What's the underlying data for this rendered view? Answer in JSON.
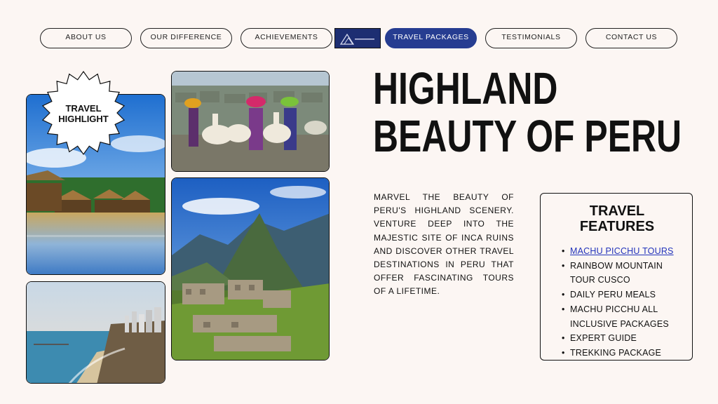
{
  "nav": {
    "items": [
      {
        "label": "ABOUT US"
      },
      {
        "label": "OUR DIFFERENCE"
      },
      {
        "label": "ACHIEVEMENTS"
      },
      {
        "label": "TRAVEL PACKAGES",
        "active": true
      },
      {
        "label": "TESTIMONIALS"
      },
      {
        "label": "CONTACT US"
      }
    ]
  },
  "badge": {
    "line1": "TRAVEL",
    "line2": "HIGHLIGHT"
  },
  "headline": {
    "line1": "HIGHLAND",
    "line2": "BEAUTY OF PERU"
  },
  "paragraph": "MARVEL THE BEAUTY OF PERU'S HIGHLAND SCENERY. VENTURE DEEP INTO THE MAJESTIC SITE OF INCA RUINS AND DISCOVER OTHER TRAVEL DESTINATIONS IN PERU THAT OFFER FASCINATING TOURS OF A LIFETIME.",
  "features": {
    "title_line1": "TRAVEL",
    "title_line2": "FEATURES",
    "items": [
      "MACHU PICCHU TOURS",
      "RAINBOW MOUNTAIN TOUR CUSCO",
      "DAILY PERU MEALS",
      "MACHU PICCHU ALL INCLUSIVE PACKAGES",
      "EXPERT GUIDE",
      "TREKKING PACKAGE"
    ]
  },
  "colors": {
    "background": "#fcf6f3",
    "accent": "#263d91"
  }
}
